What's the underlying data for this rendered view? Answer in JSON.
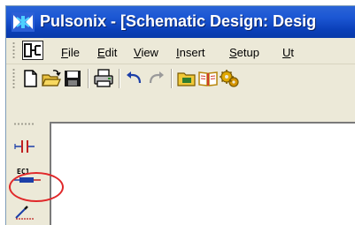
{
  "window": {
    "title": "Pulsonix - [Schematic Design: Desig"
  },
  "menubar": {
    "items": [
      {
        "label": "File",
        "mnemonic": "F",
        "rest": "ile"
      },
      {
        "label": "Edit",
        "mnemonic": "E",
        "rest": "dit"
      },
      {
        "label": "View",
        "mnemonic": "V",
        "rest": "iew"
      },
      {
        "label": "Insert",
        "mnemonic": "I",
        "rest": "nsert"
      },
      {
        "label": "Setup",
        "mnemonic": "S",
        "rest": "etup"
      },
      {
        "label": "Ut",
        "mnemonic": "U",
        "rest": "t"
      }
    ]
  },
  "toolbar": {
    "buttons": [
      "new-document-icon",
      "open-folder-icon",
      "save-icon",
      "print-icon",
      "undo-icon",
      "redo-icon",
      "folder-icon",
      "book-icon",
      "gears-icon"
    ]
  },
  "sidebar": {
    "buttons": [
      {
        "icon": "capacitor-icon"
      },
      {
        "icon": "ec1-component-icon",
        "label": "EC1",
        "highlighted": true
      },
      {
        "icon": "wire-pen-icon"
      }
    ]
  },
  "colors": {
    "titlebar": "#1c57d4",
    "chrome": "#ece9d8",
    "highlight_ring": "#e0282a"
  }
}
